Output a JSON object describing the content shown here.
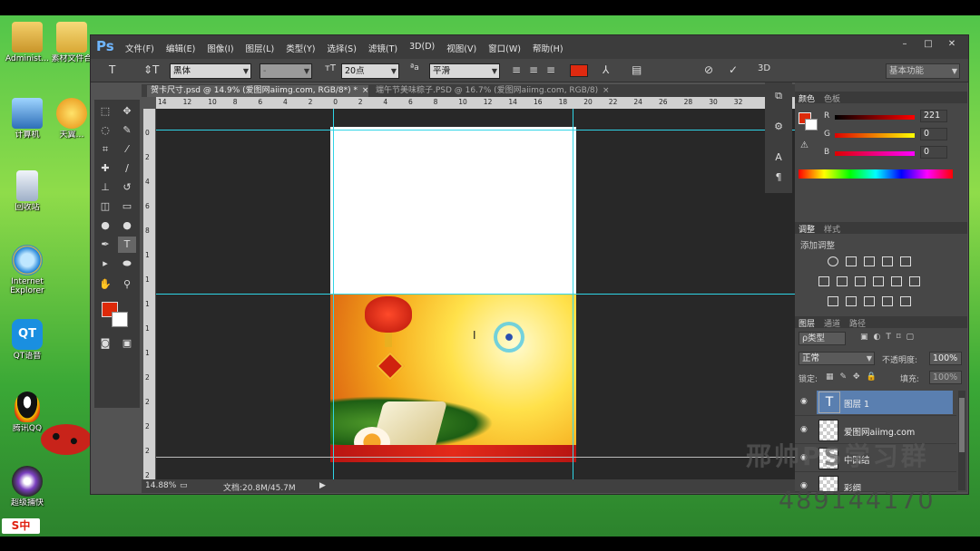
{
  "desktop": {
    "icons": [
      {
        "label": "Administ...",
        "icon": "user-folder-icon"
      },
      {
        "label": "素材文件合",
        "icon": "folder-icon"
      },
      {
        "label": "计算机",
        "icon": "computer-icon"
      },
      {
        "label": "天翼…",
        "icon": "app-icon"
      },
      {
        "label": "回收站",
        "icon": "recycle-bin-icon"
      },
      {
        "label": "Internet Explorer",
        "icon": "ie-icon"
      },
      {
        "label": "QT语音",
        "icon": "qt-icon"
      },
      {
        "label": "腾讯QQ",
        "icon": "qq-icon"
      },
      {
        "label": "超级捕快",
        "icon": "camera-icon"
      }
    ],
    "taskbar_logo": "S中"
  },
  "app": {
    "logo": "Ps",
    "menu": [
      "文件(F)",
      "编辑(E)",
      "图像(I)",
      "图层(L)",
      "类型(Y)",
      "选择(S)",
      "滤镜(T)",
      "3D(D)",
      "视图(V)",
      "窗口(W)",
      "帮助(H)"
    ],
    "window_buttons": [
      "–",
      "□",
      "✕"
    ]
  },
  "options_bar": {
    "font_family": "黑体",
    "font_style": "-",
    "font_size": "20点",
    "antialias": "平滑",
    "text_color": "#e02a10",
    "label_3d": "3D",
    "workspace": "基本功能"
  },
  "tabs": [
    {
      "label": "贺卡尺寸.psd @ 14.9% (爱图网aiimg.com, RGB/8*) *",
      "close": "×"
    },
    {
      "label": "端午节美味粽子.PSD @ 16.7% (爱图网aiimg.com, RGB/8)",
      "close": "×"
    }
  ],
  "ruler": {
    "h_ticks": [
      "14",
      "12",
      "10",
      "8",
      "6",
      "4",
      "2",
      "0",
      "2",
      "4",
      "6",
      "8",
      "10",
      "12",
      "14",
      "16",
      "18",
      "20",
      "22",
      "24",
      "26",
      "28",
      "30",
      "32"
    ],
    "v_ticks": [
      "0",
      "2",
      "4",
      "6",
      "8",
      "1",
      "1",
      "1",
      "1",
      "1",
      "2",
      "2",
      "2",
      "2",
      "2"
    ]
  },
  "status": {
    "zoom": "14.88%",
    "doc": "文档:20.8M/45.7M"
  },
  "color_panel": {
    "tabs": [
      "颜色",
      "色板"
    ],
    "fg_color": "#dd2a0a",
    "channels": [
      {
        "label": "R",
        "value": "221"
      },
      {
        "label": "G",
        "value": "0"
      },
      {
        "label": "B",
        "value": "0"
      }
    ]
  },
  "adjust_panel": {
    "tabs": [
      "调整",
      "样式"
    ],
    "title": "添加调整"
  },
  "layers_panel": {
    "tabs": [
      "图层",
      "通道",
      "路径"
    ],
    "filter": "ρ类型",
    "blend_mode": "正常",
    "opacity_label": "不透明度:",
    "opacity": "100%",
    "lock_label": "锁定:",
    "fill_label": "填充:",
    "fill": "100%",
    "layers": [
      {
        "name": "图层 1",
        "type": "text",
        "selected": true
      },
      {
        "name": "爱图网aiimg.com",
        "type": "raster",
        "selected": false
      },
      {
        "name": "中国结",
        "type": "raster",
        "selected": false
      },
      {
        "name": "彩绸",
        "type": "raster",
        "selected": false
      }
    ]
  },
  "watermark": {
    "line1": "邢帅PS学习群",
    "line2": "489144170"
  }
}
